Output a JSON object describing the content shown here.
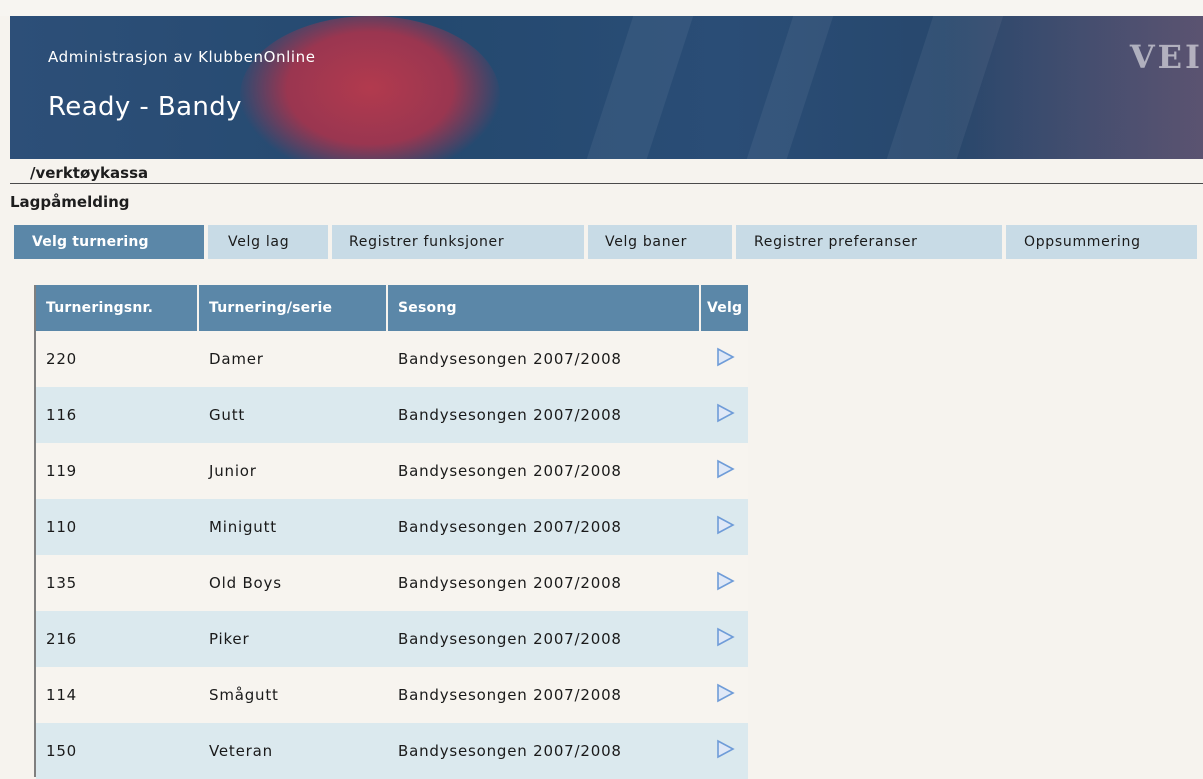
{
  "banner": {
    "subtitle": "Administrasjon av KlubbenOnline",
    "title": "Ready - Bandy",
    "brand_text": "VEI"
  },
  "breadcrumb": "/verktøykassa",
  "page_heading": "Lagpåmelding",
  "tabs": [
    {
      "label": "Velg turnering",
      "active": true
    },
    {
      "label": "Velg lag",
      "active": false
    },
    {
      "label": "Registrer funksjoner",
      "active": false
    },
    {
      "label": "Velg baner",
      "active": false
    },
    {
      "label": "Registrer preferanser",
      "active": false
    },
    {
      "label": "Oppsummering",
      "active": false
    }
  ],
  "table": {
    "headers": [
      "Turneringsnr.",
      "Turnering/serie",
      "Sesong",
      "Velg"
    ],
    "rows": [
      {
        "nr": "220",
        "name": "Damer",
        "season": "Bandysesongen 2007/2008",
        "select_icon": "play-arrow-icon"
      },
      {
        "nr": "116",
        "name": "Gutt",
        "season": "Bandysesongen 2007/2008",
        "select_icon": "play-arrow-icon"
      },
      {
        "nr": "119",
        "name": "Junior",
        "season": "Bandysesongen 2007/2008",
        "select_icon": "play-arrow-icon"
      },
      {
        "nr": "110",
        "name": "Minigutt",
        "season": "Bandysesongen 2007/2008",
        "select_icon": "play-arrow-icon"
      },
      {
        "nr": "135",
        "name": "Old Boys",
        "season": "Bandysesongen 2007/2008",
        "select_icon": "play-arrow-icon"
      },
      {
        "nr": "216",
        "name": "Piker",
        "season": "Bandysesongen 2007/2008",
        "select_icon": "play-arrow-icon"
      },
      {
        "nr": "114",
        "name": "Smågutt",
        "season": "Bandysesongen 2007/2008",
        "select_icon": "play-arrow-icon"
      },
      {
        "nr": "150",
        "name": "Veteran",
        "season": "Bandysesongen 2007/2008",
        "select_icon": "play-arrow-icon"
      }
    ]
  },
  "colors": {
    "header_blue": "#5b87a8",
    "tab_light": "#c8dbe6",
    "row_alt": "#dbe9ee",
    "banner_navy": "#24496f",
    "icon_blue": "#6f9cd8"
  }
}
